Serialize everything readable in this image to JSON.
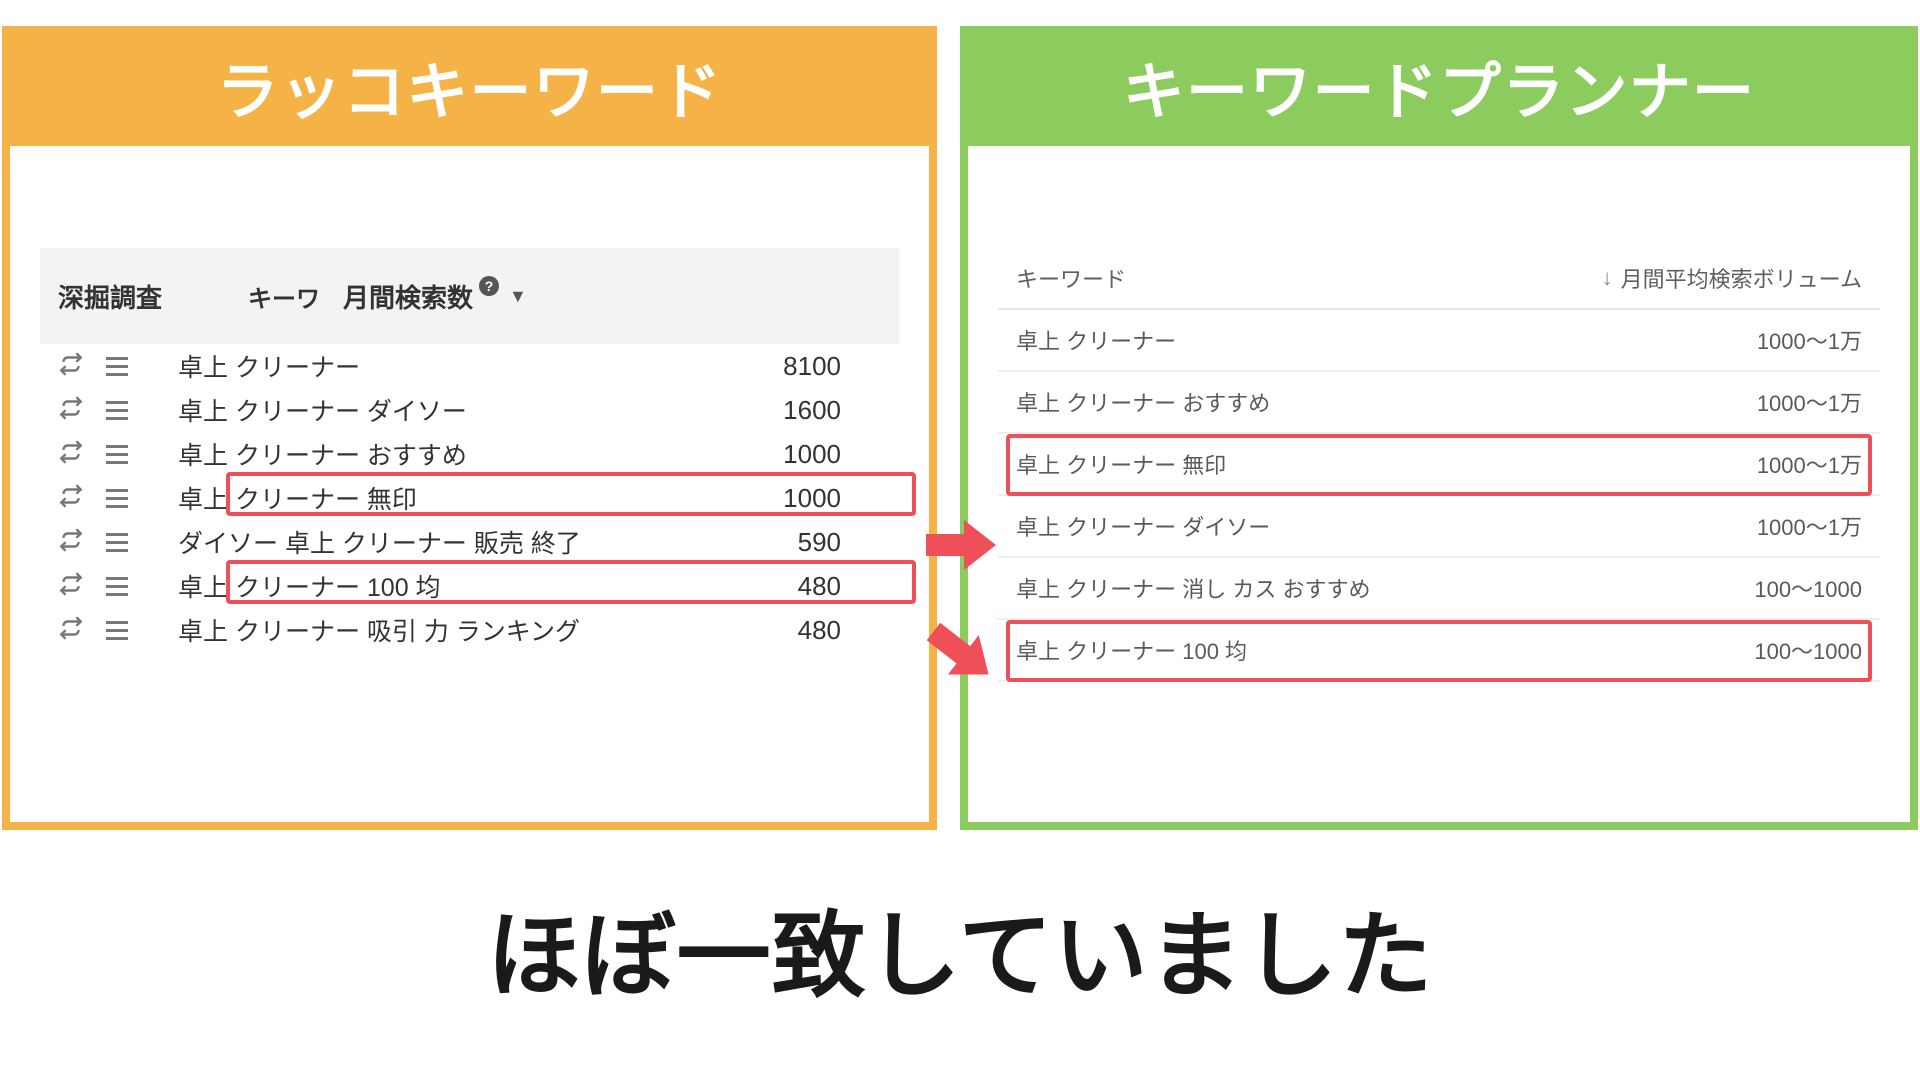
{
  "left": {
    "title": "ラッコキーワード",
    "head_dig": "深掘調査",
    "head_kw": "キーワ",
    "head_vol": "月間検索数",
    "rows": [
      {
        "kw": "卓上 クリーナー",
        "val": "8100"
      },
      {
        "kw": "卓上 クリーナー ダイソー",
        "val": "1600"
      },
      {
        "kw": "卓上 クリーナー おすすめ",
        "val": "1000"
      },
      {
        "kw": "卓上 クリーナー 無印",
        "val": "1000"
      },
      {
        "kw": "ダイソー 卓上 クリーナー 販売 終了",
        "val": "590"
      },
      {
        "kw": "卓上 クリーナー 100 均",
        "val": "480"
      },
      {
        "kw": "卓上 クリーナー 吸引 力 ランキング",
        "val": "480"
      }
    ]
  },
  "right": {
    "title": "キーワードプランナー",
    "head_kw": "キーワード",
    "head_vol": "月間平均検索ボリューム",
    "rows": [
      {
        "kw": "卓上 クリーナー",
        "val": "1000～1万"
      },
      {
        "kw": "卓上 クリーナー おすすめ",
        "val": "1000～1万"
      },
      {
        "kw": "卓上 クリーナー 無印",
        "val": "1000～1万"
      },
      {
        "kw": "卓上 クリーナー ダイソー",
        "val": "1000～1万"
      },
      {
        "kw": "卓上 クリーナー 消し カス おすすめ",
        "val": "100～1000"
      },
      {
        "kw": "卓上 クリーナー 100 均",
        "val": "100～1000"
      }
    ]
  },
  "footer": "ほぼ一致していました",
  "chart_data": [
    {
      "type": "table",
      "title": "ラッコキーワード",
      "columns": [
        "キーワード",
        "月間検索数"
      ],
      "rows": [
        [
          "卓上 クリーナー",
          8100
        ],
        [
          "卓上 クリーナー ダイソー",
          1600
        ],
        [
          "卓上 クリーナー おすすめ",
          1000
        ],
        [
          "卓上 クリーナー 無印",
          1000
        ],
        [
          "ダイソー 卓上 クリーナー 販売 終了",
          590
        ],
        [
          "卓上 クリーナー 100 均",
          480
        ],
        [
          "卓上 クリーナー 吸引 力 ランキング",
          480
        ]
      ]
    },
    {
      "type": "table",
      "title": "キーワードプランナー",
      "columns": [
        "キーワード",
        "月間平均検索ボリューム"
      ],
      "rows": [
        [
          "卓上 クリーナー",
          "1000～1万"
        ],
        [
          "卓上 クリーナー おすすめ",
          "1000～1万"
        ],
        [
          "卓上 クリーナー 無印",
          "1000～1万"
        ],
        [
          "卓上 クリーナー ダイソー",
          "1000～1万"
        ],
        [
          "卓上 クリーナー 消し カス おすすめ",
          "100～1000"
        ],
        [
          "卓上 クリーナー 100 均",
          "100～1000"
        ]
      ]
    }
  ]
}
